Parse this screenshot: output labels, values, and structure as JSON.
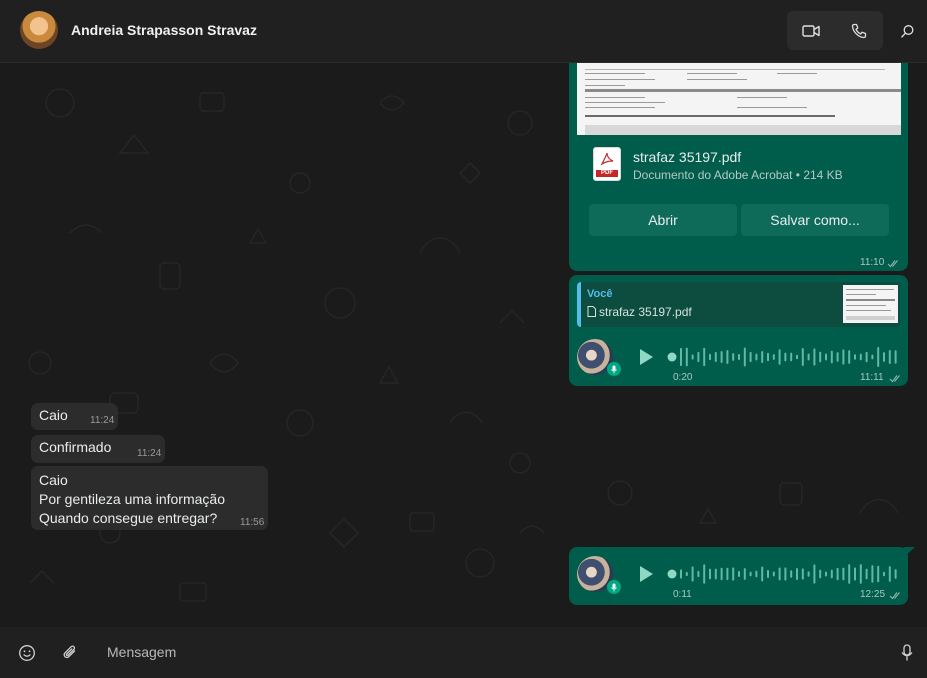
{
  "header": {
    "contact_name": "Andreia Strapasson Stravaz",
    "video_call_icon": "video-camera-icon",
    "voice_call_icon": "phone-icon",
    "search_icon": "search-icon"
  },
  "messages": {
    "document": {
      "file_name": "strafaz 35197.pdf",
      "file_meta": "Documento do Adobe Acrobat • 214 KB",
      "open_label": "Abrir",
      "save_label": "Salvar como...",
      "time": "11:10"
    },
    "voice_reply": {
      "quote_author": "Você",
      "quote_file": "strafaz 35197.pdf",
      "duration": "0:20",
      "time": "11:11"
    },
    "incoming": [
      {
        "lines": [
          "Caio"
        ],
        "time": "11:24"
      },
      {
        "lines": [
          "Confirmado"
        ],
        "time": "11:24"
      },
      {
        "lines": [
          "Caio",
          "Por gentileza uma informação",
          "Quando consegue entregar?"
        ],
        "time": "11:56"
      }
    ],
    "voice_last": {
      "duration": "0:11",
      "time": "12:25"
    }
  },
  "composer": {
    "emoji_icon": "emoji-icon",
    "attach_icon": "paperclip-icon",
    "placeholder": "Mensagem",
    "mic_icon": "microphone-icon"
  },
  "colors": {
    "outgoing_bubble": "#005c4b",
    "incoming_bubble": "#2c2c2c",
    "accent": "#00a884",
    "quote_accent": "#53bdeb"
  }
}
